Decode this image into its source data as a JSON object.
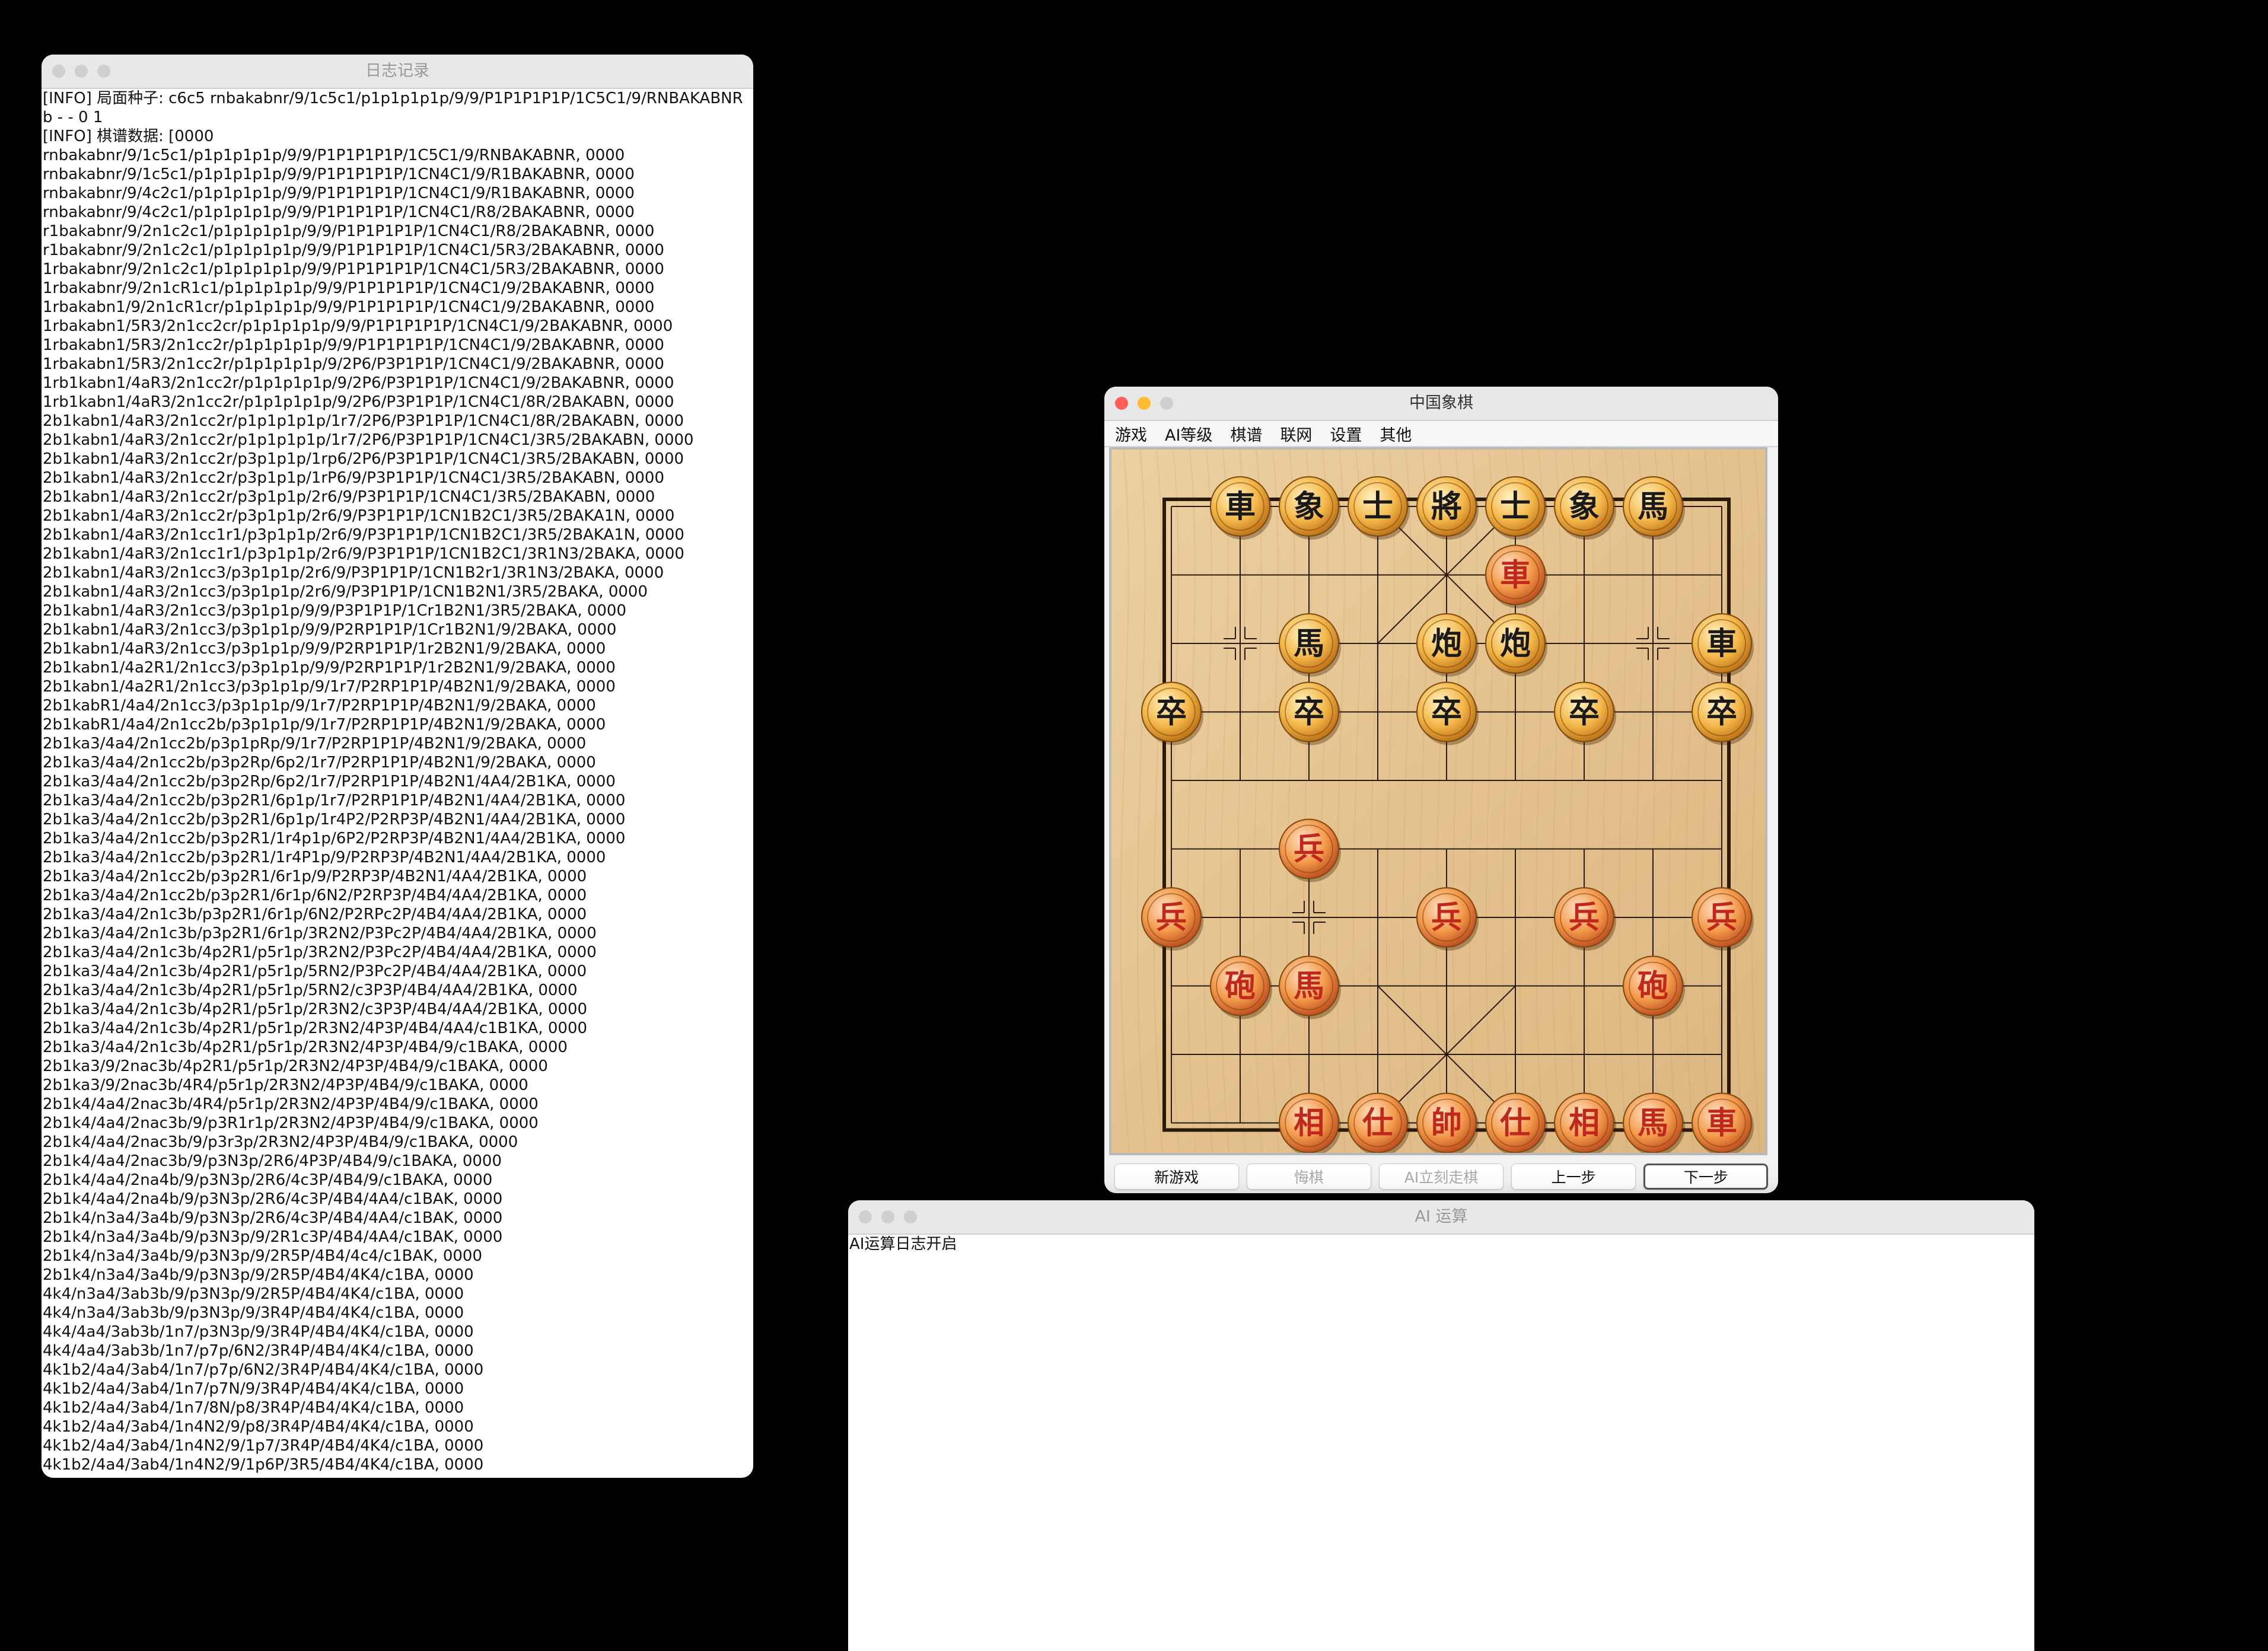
{
  "log_window": {
    "title": "日志记录",
    "lines": [
      "[INFO] 局面种子: c6c5  rnbakabnr/9/1c5c1/p1p1p1p1p/9/9/P1P1P1P1P/1C5C1/9/RNBAKABNR",
      "b - - 0 1",
      "[INFO] 棋谱数据: [0000",
      "rnbakabnr/9/1c5c1/p1p1p1p1p/9/9/P1P1P1P1P/1C5C1/9/RNBAKABNR, 0000",
      "rnbakabnr/9/1c5c1/p1p1p1p1p/9/9/P1P1P1P1P/1CN4C1/9/R1BAKABNR, 0000",
      "rnbakabnr/9/4c2c1/p1p1p1p1p/9/9/P1P1P1P1P/1CN4C1/9/R1BAKABNR, 0000",
      "rnbakabnr/9/4c2c1/p1p1p1p1p/9/9/P1P1P1P1P/1CN4C1/R8/2BAKABNR, 0000",
      "r1bakabnr/9/2n1c2c1/p1p1p1p1p/9/9/P1P1P1P1P/1CN4C1/R8/2BAKABNR, 0000",
      "r1bakabnr/9/2n1c2c1/p1p1p1p1p/9/9/P1P1P1P1P/1CN4C1/5R3/2BAKABNR, 0000",
      "1rbakabnr/9/2n1c2c1/p1p1p1p1p/9/9/P1P1P1P1P/1CN4C1/5R3/2BAKABNR, 0000",
      "1rbakabnr/9/2n1cR1c1/p1p1p1p1p/9/9/P1P1P1P1P/1CN4C1/9/2BAKABNR, 0000",
      "1rbakabn1/9/2n1cR1cr/p1p1p1p1p/9/9/P1P1P1P1P/1CN4C1/9/2BAKABNR, 0000",
      "1rbakabn1/5R3/2n1cc2cr/p1p1p1p1p/9/9/P1P1P1P1P/1CN4C1/9/2BAKABNR, 0000",
      "1rbakabn1/5R3/2n1cc2r/p1p1p1p1p/9/9/P1P1P1P1P/1CN4C1/9/2BAKABNR, 0000",
      "1rbakabn1/5R3/2n1cc2r/p1p1p1p1p/9/2P6/P3P1P1P/1CN4C1/9/2BAKABNR, 0000",
      "1rb1kabn1/4aR3/2n1cc2r/p1p1p1p1p/9/2P6/P3P1P1P/1CN4C1/9/2BAKABNR, 0000",
      "1rb1kabn1/4aR3/2n1cc2r/p1p1p1p1p/9/2P6/P3P1P1P/1CN4C1/8R/2BAKABN, 0000",
      "2b1kabn1/4aR3/2n1cc2r/p1p1p1p1p/1r7/2P6/P3P1P1P/1CN4C1/8R/2BAKABN, 0000",
      "2b1kabn1/4aR3/2n1cc2r/p1p1p1p1p/1r7/2P6/P3P1P1P/1CN4C1/3R5/2BAKABN, 0000",
      "2b1kabn1/4aR3/2n1cc2r/p3p1p1p/1rp6/2P6/P3P1P1P/1CN4C1/3R5/2BAKABN, 0000",
      "2b1kabn1/4aR3/2n1cc2r/p3p1p1p/1rP6/9/P3P1P1P/1CN4C1/3R5/2BAKABN, 0000",
      "2b1kabn1/4aR3/2n1cc2r/p3p1p1p/2r6/9/P3P1P1P/1CN4C1/3R5/2BAKABN, 0000",
      "2b1kabn1/4aR3/2n1cc2r/p3p1p1p/2r6/9/P3P1P1P/1CN1B2C1/3R5/2BAKA1N, 0000",
      "2b1kabn1/4aR3/2n1cc1r1/p3p1p1p/2r6/9/P3P1P1P/1CN1B2C1/3R5/2BAKA1N, 0000",
      "2b1kabn1/4aR3/2n1cc1r1/p3p1p1p/2r6/9/P3P1P1P/1CN1B2C1/3R1N3/2BAKA, 0000",
      "2b1kabn1/4aR3/2n1cc3/p3p1p1p/2r6/9/P3P1P1P/1CN1B2r1/3R1N3/2BAKA, 0000",
      "2b1kabn1/4aR3/2n1cc3/p3p1p1p/2r6/9/P3P1P1P/1CN1B2N1/3R5/2BAKA, 0000",
      "2b1kabn1/4aR3/2n1cc3/p3p1p1p/9/9/P3P1P1P/1Cr1B2N1/3R5/2BAKA, 0000",
      "2b1kabn1/4aR3/2n1cc3/p3p1p1p/9/9/P2RP1P1P/1Cr1B2N1/9/2BAKA, 0000",
      "2b1kabn1/4aR3/2n1cc3/p3p1p1p/9/9/P2RP1P1P/1r2B2N1/9/2BAKA, 0000",
      "2b1kabn1/4a2R1/2n1cc3/p3p1p1p/9/9/P2RP1P1P/1r2B2N1/9/2BAKA, 0000",
      "2b1kabn1/4a2R1/2n1cc3/p3p1p1p/9/1r7/P2RP1P1P/4B2N1/9/2BAKA, 0000",
      "2b1kabR1/4a4/2n1cc3/p3p1p1p/9/1r7/P2RP1P1P/4B2N1/9/2BAKA, 0000",
      "2b1kabR1/4a4/2n1cc2b/p3p1p1p/9/1r7/P2RP1P1P/4B2N1/9/2BAKA, 0000",
      "2b1ka3/4a4/2n1cc2b/p3p1pRp/9/1r7/P2RP1P1P/4B2N1/9/2BAKA, 0000",
      "2b1ka3/4a4/2n1cc2b/p3p2Rp/6p2/1r7/P2RP1P1P/4B2N1/9/2BAKA, 0000",
      "2b1ka3/4a4/2n1cc2b/p3p2Rp/6p2/1r7/P2RP1P1P/4B2N1/4A4/2B1KA, 0000",
      "2b1ka3/4a4/2n1cc2b/p3p2R1/6p1p/1r7/P2RP1P1P/4B2N1/4A4/2B1KA, 0000",
      "2b1ka3/4a4/2n1cc2b/p3p2R1/6p1p/1r4P2/P2RP3P/4B2N1/4A4/2B1KA, 0000",
      "2b1ka3/4a4/2n1cc2b/p3p2R1/1r4p1p/6P2/P2RP3P/4B2N1/4A4/2B1KA, 0000",
      "2b1ka3/4a4/2n1cc2b/p3p2R1/1r4P1p/9/P2RP3P/4B2N1/4A4/2B1KA, 0000",
      "2b1ka3/4a4/2n1cc2b/p3p2R1/6r1p/9/P2RP3P/4B2N1/4A4/2B1KA, 0000",
      "2b1ka3/4a4/2n1cc2b/p3p2R1/6r1p/6N2/P2RP3P/4B4/4A4/2B1KA, 0000",
      "2b1ka3/4a4/2n1c3b/p3p2R1/6r1p/6N2/P2RPc2P/4B4/4A4/2B1KA, 0000",
      "2b1ka3/4a4/2n1c3b/p3p2R1/6r1p/3R2N2/P3Pc2P/4B4/4A4/2B1KA, 0000",
      "2b1ka3/4a4/2n1c3b/4p2R1/p5r1p/3R2N2/P3Pc2P/4B4/4A4/2B1KA, 0000",
      "2b1ka3/4a4/2n1c3b/4p2R1/p5r1p/5RN2/P3Pc2P/4B4/4A4/2B1KA, 0000",
      "2b1ka3/4a4/2n1c3b/4p2R1/p5r1p/5RN2/c3P3P/4B4/4A4/2B1KA, 0000",
      "2b1ka3/4a4/2n1c3b/4p2R1/p5r1p/2R3N2/c3P3P/4B4/4A4/2B1KA, 0000",
      "2b1ka3/4a4/2n1c3b/4p2R1/p5r1p/2R3N2/4P3P/4B4/4A4/c1B1KA, 0000",
      "2b1ka3/4a4/2n1c3b/4p2R1/p5r1p/2R3N2/4P3P/4B4/9/c1BAKA, 0000",
      "2b1ka3/9/2nac3b/4p2R1/p5r1p/2R3N2/4P3P/4B4/9/c1BAKA, 0000",
      "2b1ka3/9/2nac3b/4R4/p5r1p/2R3N2/4P3P/4B4/9/c1BAKA, 0000",
      "2b1k4/4a4/2nac3b/4R4/p5r1p/2R3N2/4P3P/4B4/9/c1BAKA, 0000",
      "2b1k4/4a4/2nac3b/9/p3R1r1p/2R3N2/4P3P/4B4/9/c1BAKA, 0000",
      "2b1k4/4a4/2nac3b/9/p3r3p/2R3N2/4P3P/4B4/9/c1BAKA, 0000",
      "2b1k4/4a4/2nac3b/9/p3N3p/2R6/4P3P/4B4/9/c1BAKA, 0000",
      "2b1k4/4a4/2na4b/9/p3N3p/2R6/4c3P/4B4/9/c1BAKA, 0000",
      "2b1k4/4a4/2na4b/9/p3N3p/2R6/4c3P/4B4/4A4/c1BAK, 0000",
      "2b1k4/n3a4/3a4b/9/p3N3p/2R6/4c3P/4B4/4A4/c1BAK, 0000",
      "2b1k4/n3a4/3a4b/9/p3N3p/9/2R1c3P/4B4/4A4/c1BAK, 0000",
      "2b1k4/n3a4/3a4b/9/p3N3p/9/2R5P/4B4/4c4/c1BAK, 0000",
      "2b1k4/n3a4/3a4b/9/p3N3p/9/2R5P/4B4/4K4/c1BA, 0000",
      "4k4/n3a4/3ab3b/9/p3N3p/9/2R5P/4B4/4K4/c1BA, 0000",
      "4k4/n3a4/3ab3b/9/p3N3p/9/3R4P/4B4/4K4/c1BA, 0000",
      "4k4/4a4/3ab3b/1n7/p3N3p/9/3R4P/4B4/4K4/c1BA, 0000",
      "4k4/4a4/3ab3b/1n7/p7p/6N2/3R4P/4B4/4K4/c1BA, 0000",
      "4k1b2/4a4/3ab4/1n7/p7p/6N2/3R4P/4B4/4K4/c1BA, 0000",
      "4k1b2/4a4/3ab4/1n7/p7N/9/3R4P/4B4/4K4/c1BA, 0000",
      "4k1b2/4a4/3ab4/1n7/8N/p8/3R4P/4B4/4K4/c1BA, 0000",
      "4k1b2/4a4/3ab4/1n4N2/9/p8/3R4P/4B4/4K4/c1BA, 0000",
      "4k1b2/4a4/3ab4/1n4N2/9/1p7/3R4P/4B4/4K4/c1BA, 0000",
      "4k1b2/4a4/3ab4/1n4N2/9/1p6P/3R5/4B4/4K4/c1BA, 0000"
    ]
  },
  "chess_window": {
    "title": "中国象棋",
    "menu": [
      "游戏",
      "AI等级",
      "棋谱",
      "联网",
      "设置",
      "其他"
    ],
    "pieces": [
      {
        "char": "車",
        "color": "black",
        "file": 1,
        "rank": 0
      },
      {
        "char": "象",
        "color": "black",
        "file": 2,
        "rank": 0
      },
      {
        "char": "士",
        "color": "black",
        "file": 3,
        "rank": 0
      },
      {
        "char": "將",
        "color": "black",
        "file": 4,
        "rank": 0
      },
      {
        "char": "士",
        "color": "black",
        "file": 5,
        "rank": 0
      },
      {
        "char": "象",
        "color": "black",
        "file": 6,
        "rank": 0
      },
      {
        "char": "馬",
        "color": "black",
        "file": 7,
        "rank": 0
      },
      {
        "char": "車",
        "color": "red",
        "file": 5,
        "rank": 1
      },
      {
        "char": "馬",
        "color": "black",
        "file": 2,
        "rank": 2
      },
      {
        "char": "炮",
        "color": "black",
        "file": 4,
        "rank": 2
      },
      {
        "char": "炮",
        "color": "black",
        "file": 5,
        "rank": 2
      },
      {
        "char": "車",
        "color": "black",
        "file": 8,
        "rank": 2
      },
      {
        "char": "卒",
        "color": "black",
        "file": 0,
        "rank": 3
      },
      {
        "char": "卒",
        "color": "black",
        "file": 2,
        "rank": 3
      },
      {
        "char": "卒",
        "color": "black",
        "file": 4,
        "rank": 3
      },
      {
        "char": "卒",
        "color": "black",
        "file": 6,
        "rank": 3
      },
      {
        "char": "卒",
        "color": "black",
        "file": 8,
        "rank": 3
      },
      {
        "char": "兵",
        "color": "red",
        "file": 2,
        "rank": 5
      },
      {
        "char": "兵",
        "color": "red",
        "file": 0,
        "rank": 6
      },
      {
        "char": "兵",
        "color": "red",
        "file": 4,
        "rank": 6
      },
      {
        "char": "兵",
        "color": "red",
        "file": 6,
        "rank": 6
      },
      {
        "char": "兵",
        "color": "red",
        "file": 8,
        "rank": 6
      },
      {
        "char": "砲",
        "color": "red",
        "file": 1,
        "rank": 7
      },
      {
        "char": "馬",
        "color": "red",
        "file": 2,
        "rank": 7
      },
      {
        "char": "砲",
        "color": "red",
        "file": 7,
        "rank": 7
      },
      {
        "char": "相",
        "color": "red",
        "file": 2,
        "rank": 9
      },
      {
        "char": "仕",
        "color": "red",
        "file": 3,
        "rank": 9
      },
      {
        "char": "帥",
        "color": "red",
        "file": 4,
        "rank": 9
      },
      {
        "char": "仕",
        "color": "red",
        "file": 5,
        "rank": 9
      },
      {
        "char": "相",
        "color": "red",
        "file": 6,
        "rank": 9
      },
      {
        "char": "馬",
        "color": "red",
        "file": 7,
        "rank": 9
      },
      {
        "char": "車",
        "color": "red",
        "file": 8,
        "rank": 9
      }
    ],
    "buttons": {
      "new_game": "新游戏",
      "undo": "悔棋",
      "ai_move": "AI立刻走棋",
      "prev": "上一步",
      "next": "下一步"
    }
  },
  "ai_window": {
    "title": "AI 运算",
    "text": "AI运算日志开启"
  },
  "colors": {
    "board_wood": "#e6c48f",
    "red_piece_text": "#c0281c",
    "black_piece_text": "#1a1a1a"
  }
}
